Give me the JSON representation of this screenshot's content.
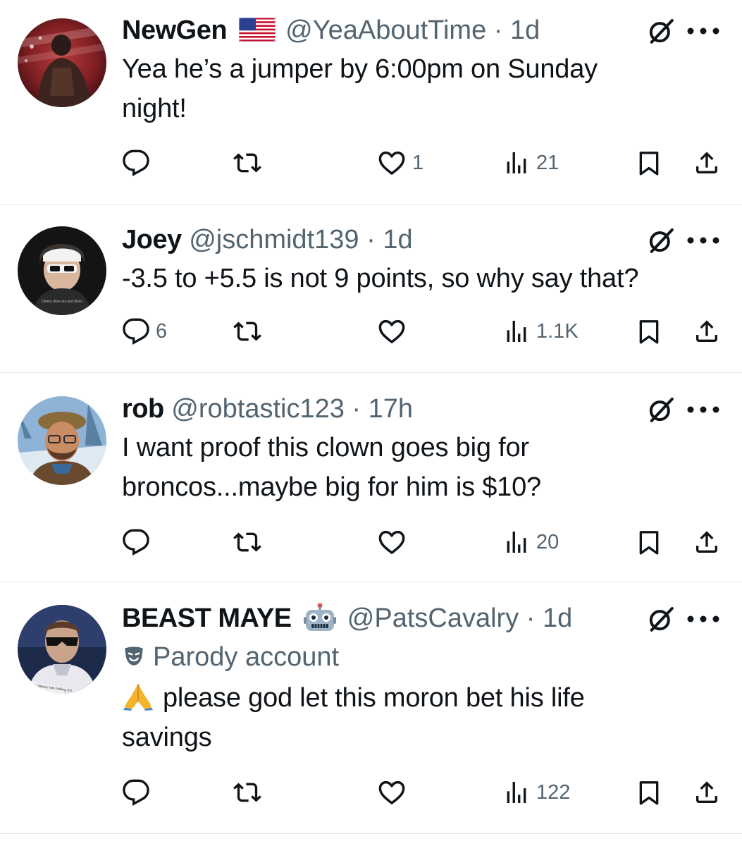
{
  "tweets": [
    {
      "name": "NewGen",
      "badge": "us-flag-emoji",
      "handle": "@YeaAboutTime",
      "dot": "·",
      "time": "1d",
      "label": "",
      "text_lines": [
        "Yea he’s a jumper by 6:00pm on Sunday",
        "night!"
      ],
      "replies": "",
      "retweets": "",
      "likes": "1",
      "views": "21"
    },
    {
      "name": "Joey",
      "badge": "",
      "handle": "@jschmidt139",
      "dot": "·",
      "time": "1d",
      "label": "",
      "text_lines": [
        "-3.5 to +5.5 is not 9 points, so why say that?"
      ],
      "replies": "6",
      "retweets": "",
      "likes": "",
      "views": "1.1K"
    },
    {
      "name": "rob",
      "badge": "",
      "handle": "@robtastic123",
      "dot": "·",
      "time": "17h",
      "label": "",
      "text_lines": [
        "I want proof this clown goes big for",
        "broncos...maybe big for him is $10?"
      ],
      "replies": "",
      "retweets": "",
      "likes": "",
      "views": "20"
    },
    {
      "name": "BEAST MAYE",
      "badge": "robot-emoji",
      "handle": "@PatsCavalry",
      "dot": "·",
      "time": "1d",
      "label": "Parody account",
      "text_lines": [
        "please god let this moron bet his life",
        "savings"
      ],
      "leading_emoji": "folded-hands-emoji",
      "replies": "",
      "retweets": "",
      "likes": "",
      "views": "122"
    }
  ],
  "avatar_1_caption": "Diners drive-ins and dives",
  "avatar_3_caption": "NBA Finals history has trailing 3-1",
  "colors": {
    "text_primary": "#0f1419",
    "text_secondary": "#536471",
    "divider": "#e4e7ea"
  },
  "icons": [
    "reply-icon",
    "retweet-icon",
    "like-icon",
    "views-icon",
    "bookmark-icon",
    "share-icon",
    "grok-icon",
    "more-icon"
  ]
}
